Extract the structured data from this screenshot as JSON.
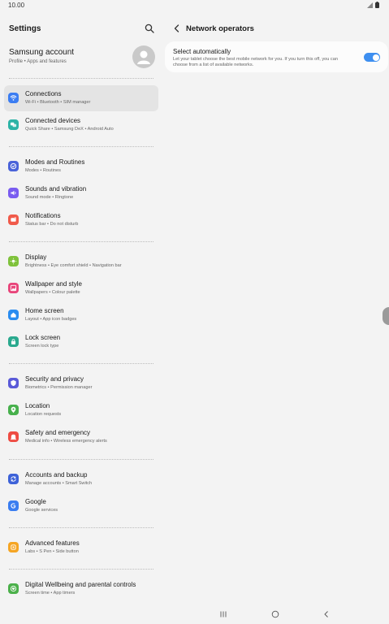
{
  "status": {
    "time": "10.00"
  },
  "left": {
    "title": "Settings",
    "account": {
      "name": "Samsung account",
      "sub": "Profile  •  Apps and features"
    },
    "items": [
      {
        "label": "Connections",
        "sub": "Wi-Fi  •  Bluetooth  •  SIM manager",
        "icon": "wifi-icon",
        "color": "#3b7df2"
      },
      {
        "label": "Connected devices",
        "sub": "Quick Share  •  Samsung DeX  •  Android Auto",
        "icon": "devices-icon",
        "color": "#2bb3a6"
      },
      {
        "label": "Modes and Routines",
        "sub": "Modes  •  Routines",
        "icon": "check-circle-icon",
        "color": "#4a63d9"
      },
      {
        "label": "Sounds and vibration",
        "sub": "Sound mode  •  Ringtone",
        "icon": "volume-icon",
        "color": "#7a5cf0"
      },
      {
        "label": "Notifications",
        "sub": "Status bar  •  Do not disturb",
        "icon": "bell-icon",
        "color": "#f05a4a"
      },
      {
        "label": "Display",
        "sub": "Brightness  •  Eye comfort shield  •  Navigation bar",
        "icon": "sun-icon",
        "color": "#7fc23b"
      },
      {
        "label": "Wallpaper and style",
        "sub": "Wallpapers  •  Colour palette",
        "icon": "image-icon",
        "color": "#e8457a"
      },
      {
        "label": "Home screen",
        "sub": "Layout  •  App icon badges",
        "icon": "home-icon",
        "color": "#2a8cf0"
      },
      {
        "label": "Lock screen",
        "sub": "Screen lock type",
        "icon": "lock-icon",
        "color": "#2aa98e"
      },
      {
        "label": "Security and privacy",
        "sub": "Biometrics  •  Permission manager",
        "icon": "shield-icon",
        "color": "#5a5ad8"
      },
      {
        "label": "Location",
        "sub": "Location requests",
        "icon": "location-pin-icon",
        "color": "#47b04c"
      },
      {
        "label": "Safety and emergency",
        "sub": "Medical info  •  Wireless emergency alerts",
        "icon": "alert-icon",
        "color": "#ee4c43"
      },
      {
        "label": "Accounts and backup",
        "sub": "Manage accounts  •  Smart Switch",
        "icon": "sync-icon",
        "color": "#3d62d8"
      },
      {
        "label": "Google",
        "sub": "Google services",
        "icon": "google-icon",
        "color": "#3a7df0"
      },
      {
        "label": "Advanced features",
        "sub": "Labs  •  S Pen  •  Side button",
        "icon": "star-icon",
        "color": "#f5a524"
      },
      {
        "label": "Digital Wellbeing and parental controls",
        "sub": "Screen time  •  App timers",
        "icon": "heart-icon",
        "color": "#4bb04a"
      }
    ]
  },
  "right": {
    "title": "Network operators",
    "setting": {
      "label": "Select automatically",
      "desc": "Let your tablet choose the best mobile network for you. If you turn this off, you can choose from a list of available networks.",
      "enabled": true
    }
  }
}
